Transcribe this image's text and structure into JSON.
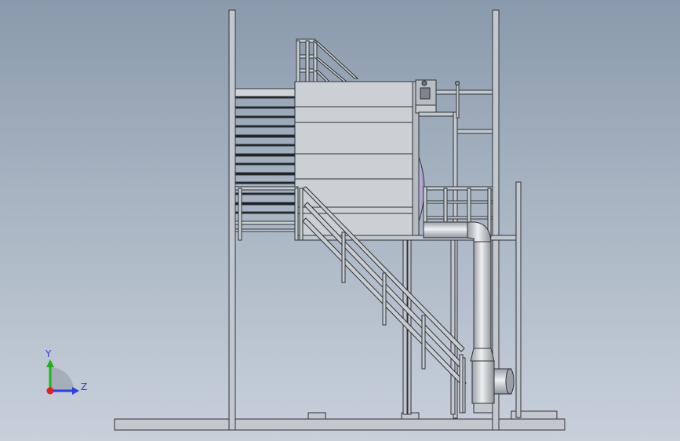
{
  "triad": {
    "y_label": "Y",
    "z_label": "Z",
    "colors": {
      "y": "#1fb21f",
      "z": "#2a3fe0",
      "x": "#e02020"
    }
  },
  "palette": {
    "steel": "#bfc5cc",
    "steel_dark": "#3a3f45",
    "panel": "#c9ced4",
    "duct": "#d4d8dc"
  }
}
